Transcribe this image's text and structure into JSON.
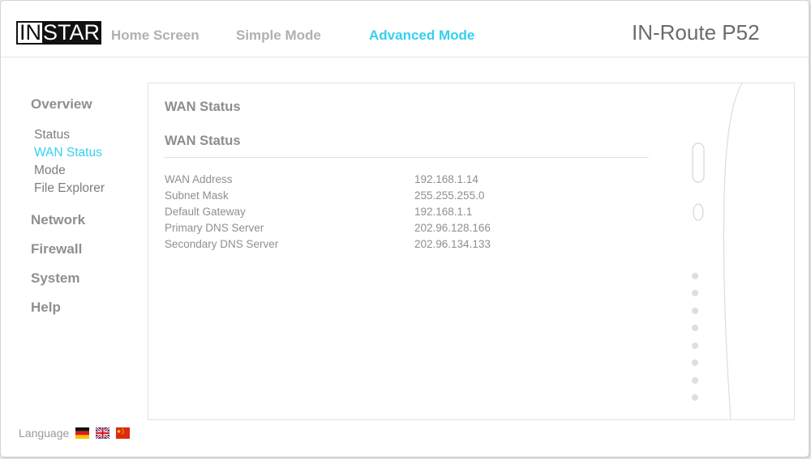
{
  "header": {
    "logo_in": "IN",
    "logo_star": "STAR",
    "nav": {
      "home": "Home Screen",
      "simple": "Simple Mode",
      "advanced": "Advanced Mode"
    },
    "model": "IN-Route P52"
  },
  "sidebar": {
    "overview": "Overview",
    "overview_items": [
      "Status",
      "WAN Status",
      "Mode",
      "File Explorer"
    ],
    "network": "Network",
    "firewall": "Firewall",
    "system": "System",
    "help": "Help"
  },
  "main": {
    "panel_title": "WAN Status",
    "section_title": "WAN Status",
    "rows": [
      {
        "label": "WAN Address",
        "value": "192.168.1.14"
      },
      {
        "label": "Subnet Mask",
        "value": "255.255.255.0"
      },
      {
        "label": "Default Gateway",
        "value": "192.168.1.1"
      },
      {
        "label": "Primary DNS Server",
        "value": "202.96.128.166"
      },
      {
        "label": "Secondary DNS Server",
        "value": "202.96.134.133"
      }
    ]
  },
  "footer": {
    "language_label": "Language",
    "flags": [
      "german-flag-icon",
      "uk-flag-icon",
      "china-flag-icon"
    ]
  },
  "colors": {
    "accent": "#35d0f0",
    "muted": "#8f8f8f"
  }
}
